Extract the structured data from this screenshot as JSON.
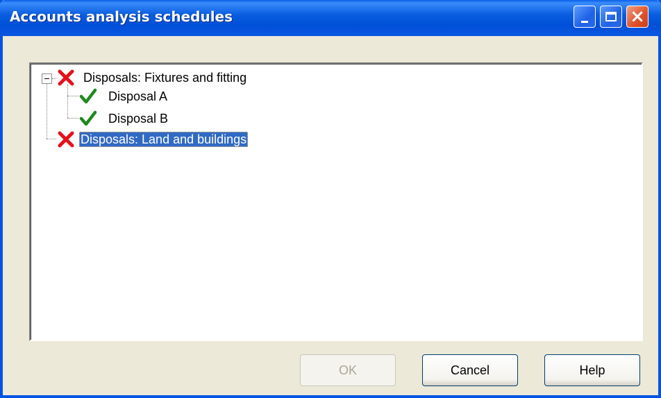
{
  "window": {
    "title": "Accounts analysis schedules",
    "buttons": {
      "minimize": "minimize-icon",
      "maximize": "maximize-icon",
      "close": "close-icon"
    }
  },
  "tree": {
    "expander_state": "expanded",
    "nodes": [
      {
        "label": "Disposals: Fixtures and fitting",
        "status": "error",
        "icon": "red-x-icon",
        "level": 0,
        "selected": false
      },
      {
        "label": "Disposal A",
        "status": "ok",
        "icon": "green-check-icon",
        "level": 1,
        "selected": false
      },
      {
        "label": "Disposal B",
        "status": "ok",
        "icon": "green-check-icon",
        "level": 1,
        "selected": false
      },
      {
        "label": "Disposals: Land and buildings",
        "status": "error",
        "icon": "red-x-icon",
        "level": 0,
        "selected": true
      }
    ]
  },
  "footer": {
    "ok_label": "OK",
    "ok_enabled": false,
    "cancel_label": "Cancel",
    "help_label": "Help"
  },
  "colors": {
    "titlebar": "#0054e3",
    "selection": "#316ac5",
    "error": "#e8101a",
    "ok": "#1d8a1d"
  }
}
